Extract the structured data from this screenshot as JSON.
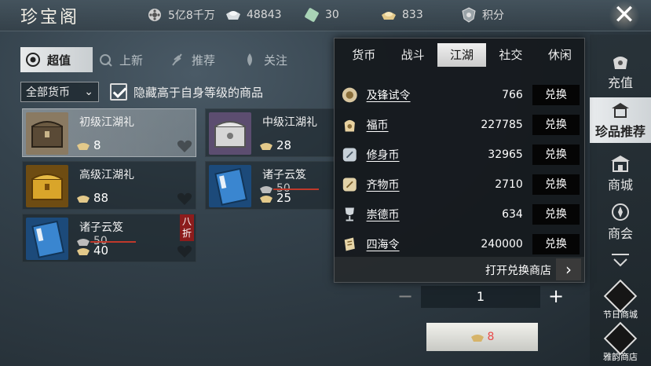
{
  "header": {
    "title": "珍宝阁",
    "currencies": [
      {
        "icon": "film-reel-coin-icon",
        "value": "5亿8千万"
      },
      {
        "icon": "silver-ingot-icon",
        "value": "48843"
      },
      {
        "icon": "jade-token-icon",
        "value": "30"
      },
      {
        "icon": "gold-ingot-icon",
        "value": "833"
      },
      {
        "icon": "points-shield-icon",
        "value": "积分"
      }
    ],
    "close_icon": "close-icon"
  },
  "tabs": [
    {
      "label": "超值",
      "icon": "target-icon",
      "active": true
    },
    {
      "label": "上新",
      "icon": "new-flower-icon",
      "active": false
    },
    {
      "label": "推荐",
      "icon": "recommend-feather-icon",
      "active": false
    },
    {
      "label": "关注",
      "icon": "follow-leaf-icon",
      "active": false
    }
  ],
  "filter": {
    "currency_select": "全部货币",
    "hide_label": "隐藏高于自身等级的商品",
    "hide_checked": true
  },
  "items": [
    {
      "name": "初级江湖礼",
      "price": "8",
      "selected": true,
      "thumb_color": "#6b5d48"
    },
    {
      "name": "中级江湖礼",
      "price": "28",
      "selected": false,
      "thumb_color": "#7a6a8a"
    },
    {
      "name": "高级江湖礼",
      "price": "88",
      "selected": false,
      "thumb_color": "#8a6418"
    },
    {
      "name": "诸子云笈",
      "old_price": "50",
      "price": "25",
      "selected": false,
      "thumb_color": "#2a6aa8"
    },
    {
      "name": "诸子云笈",
      "old_price": "50",
      "price": "40",
      "discount": "八折",
      "selected": false,
      "thumb_color": "#2a6aa8"
    }
  ],
  "detail": {
    "quantity": "1",
    "buy_price": "8"
  },
  "rightnav": [
    {
      "label": "充值",
      "icon": "recharge-bag-icon",
      "active": false
    },
    {
      "label": "珍品推荐",
      "icon": "treasure-pavilion-icon",
      "active": true
    },
    {
      "label": "商城",
      "icon": "mall-building-icon",
      "active": false
    },
    {
      "label": "商会",
      "icon": "guild-emblem-icon",
      "active": false
    }
  ],
  "festival": [
    {
      "label": "节日商城",
      "icon": "festival-shop-icon"
    },
    {
      "label": "雅韵商店",
      "icon": "elegance-shop-icon"
    }
  ],
  "popup": {
    "tabs": [
      {
        "label": "货币",
        "active": false
      },
      {
        "label": "战斗",
        "active": false
      },
      {
        "label": "江湖",
        "active": true
      },
      {
        "label": "社交",
        "active": false
      },
      {
        "label": "休闲",
        "active": false
      }
    ],
    "rows": [
      {
        "name": "及锋试令",
        "count": "766",
        "btn": "兑换",
        "icon": "medal-token-icon"
      },
      {
        "name": "福币",
        "count": "227785",
        "btn": "兑换",
        "icon": "fortune-bag-icon"
      },
      {
        "name": "修身币",
        "count": "32965",
        "btn": "兑换",
        "icon": "cultivation-coin-icon"
      },
      {
        "name": "齐物币",
        "count": "2710",
        "btn": "兑换",
        "icon": "qiwu-coin-icon"
      },
      {
        "name": "崇德币",
        "count": "634",
        "btn": "兑换",
        "icon": "trophy-icon"
      },
      {
        "name": "四海令",
        "count": "240000",
        "btn": "兑换",
        "icon": "scroll-token-icon"
      }
    ],
    "footer_label": "打开兑换商店",
    "footer_arrow": "›"
  },
  "colors": {
    "accent_red": "#c0392b",
    "buy_price_red": "#e94a4a",
    "discount_bg": "#8c1c1c"
  }
}
